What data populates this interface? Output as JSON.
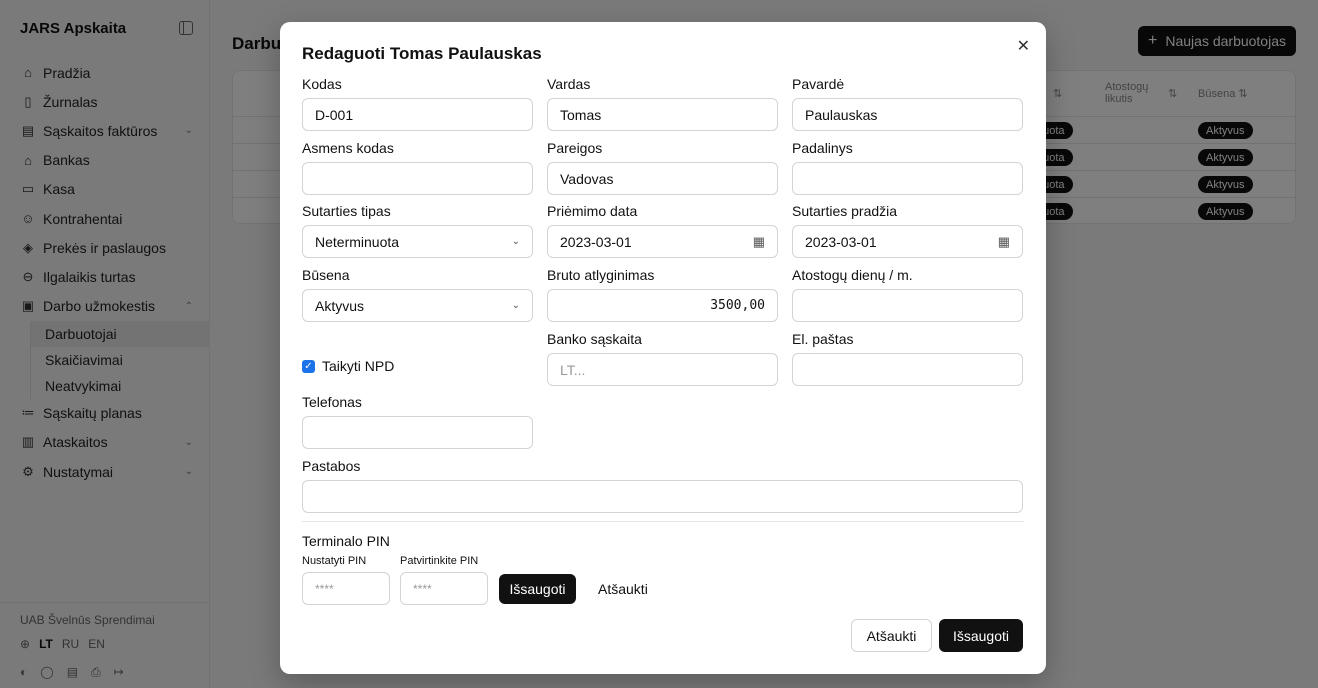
{
  "sidebar": {
    "app_title": "JARS Apskaita",
    "items": [
      {
        "label": "Pradžia",
        "icon": "home-icon"
      },
      {
        "label": "Žurnalas",
        "icon": "book-icon"
      },
      {
        "label": "Sąskaitos faktūros",
        "icon": "file-icon",
        "chevron": "down"
      },
      {
        "label": "Bankas",
        "icon": "bank-icon"
      },
      {
        "label": "Kasa",
        "icon": "cash-icon"
      },
      {
        "label": "Kontrahentai",
        "icon": "users-icon"
      },
      {
        "label": "Prekės ir paslaugos",
        "icon": "package-icon"
      },
      {
        "label": "Ilgalaikis turtas",
        "icon": "drive-icon"
      },
      {
        "label": "Darbo užmokestis",
        "icon": "wallet-icon",
        "chevron": "up"
      }
    ],
    "subitems": [
      "Darbuotojai",
      "Skaičiavimai",
      "Neatvykimai"
    ],
    "items_after": [
      {
        "label": "Sąskaitų planas",
        "icon": "list-tree-icon"
      },
      {
        "label": "Ataskaitos",
        "icon": "bar-chart-icon",
        "chevron": "down"
      },
      {
        "label": "Nustatymai",
        "icon": "gear-icon",
        "chevron": "down"
      }
    ],
    "company": "UAB Švelnūs Sprendimai",
    "languages": [
      "LT",
      "RU",
      "EN"
    ],
    "active_language": "LT"
  },
  "main": {
    "title": "Darbu",
    "new_button": "Naujas darbuotojas",
    "table_headers": {
      "leave": "Atostogų likutis",
      "status": "Būsena"
    },
    "rows": [
      {
        "type": "nuota",
        "status": "Aktyvus"
      },
      {
        "type": "nuota",
        "status": "Aktyvus"
      },
      {
        "type": "nuota",
        "status": "Aktyvus"
      },
      {
        "type": "nuota",
        "status": "Aktyvus"
      }
    ]
  },
  "modal": {
    "title": "Redaguoti Tomas Paulauskas",
    "fields": {
      "kodas": {
        "label": "Kodas",
        "value": "D-001"
      },
      "vardas": {
        "label": "Vardas",
        "value": "Tomas"
      },
      "pavarde": {
        "label": "Pavardė",
        "value": "Paulauskas"
      },
      "asmens_kodas": {
        "label": "Asmens kodas",
        "value": ""
      },
      "pareigos": {
        "label": "Pareigos",
        "value": "Vadovas"
      },
      "padalinys": {
        "label": "Padalinys",
        "value": ""
      },
      "sutarties_tipas": {
        "label": "Sutarties tipas",
        "value": "Neterminuota"
      },
      "priemimo_data": {
        "label": "Priėmimo data",
        "value": "2023-03-01"
      },
      "sutarties_pradzia": {
        "label": "Sutarties pradžia",
        "value": "2023-03-01"
      },
      "busena": {
        "label": "Būsena",
        "value": "Aktyvus"
      },
      "bruto": {
        "label": "Bruto atlyginimas",
        "value": "3500,00"
      },
      "atostogu": {
        "label": "Atostogų dienų / m.",
        "value": ""
      },
      "banko": {
        "label": "Banko sąskaita",
        "placeholder": "LT..."
      },
      "el_pastas": {
        "label": "El. paštas",
        "value": ""
      },
      "telefonas": {
        "label": "Telefonas",
        "value": ""
      },
      "pastabos": {
        "label": "Pastabos",
        "value": ""
      }
    },
    "npd": {
      "label": "Taikyti NPD",
      "checked": true
    },
    "pin": {
      "title": "Terminalo PIN",
      "set_label": "Nustatyti PIN",
      "confirm_label": "Patvirtinkite PIN",
      "placeholder": "****",
      "save": "Išsaugoti",
      "cancel": "Atšaukti"
    },
    "footer": {
      "cancel": "Atšaukti",
      "save": "Išsaugoti"
    }
  }
}
